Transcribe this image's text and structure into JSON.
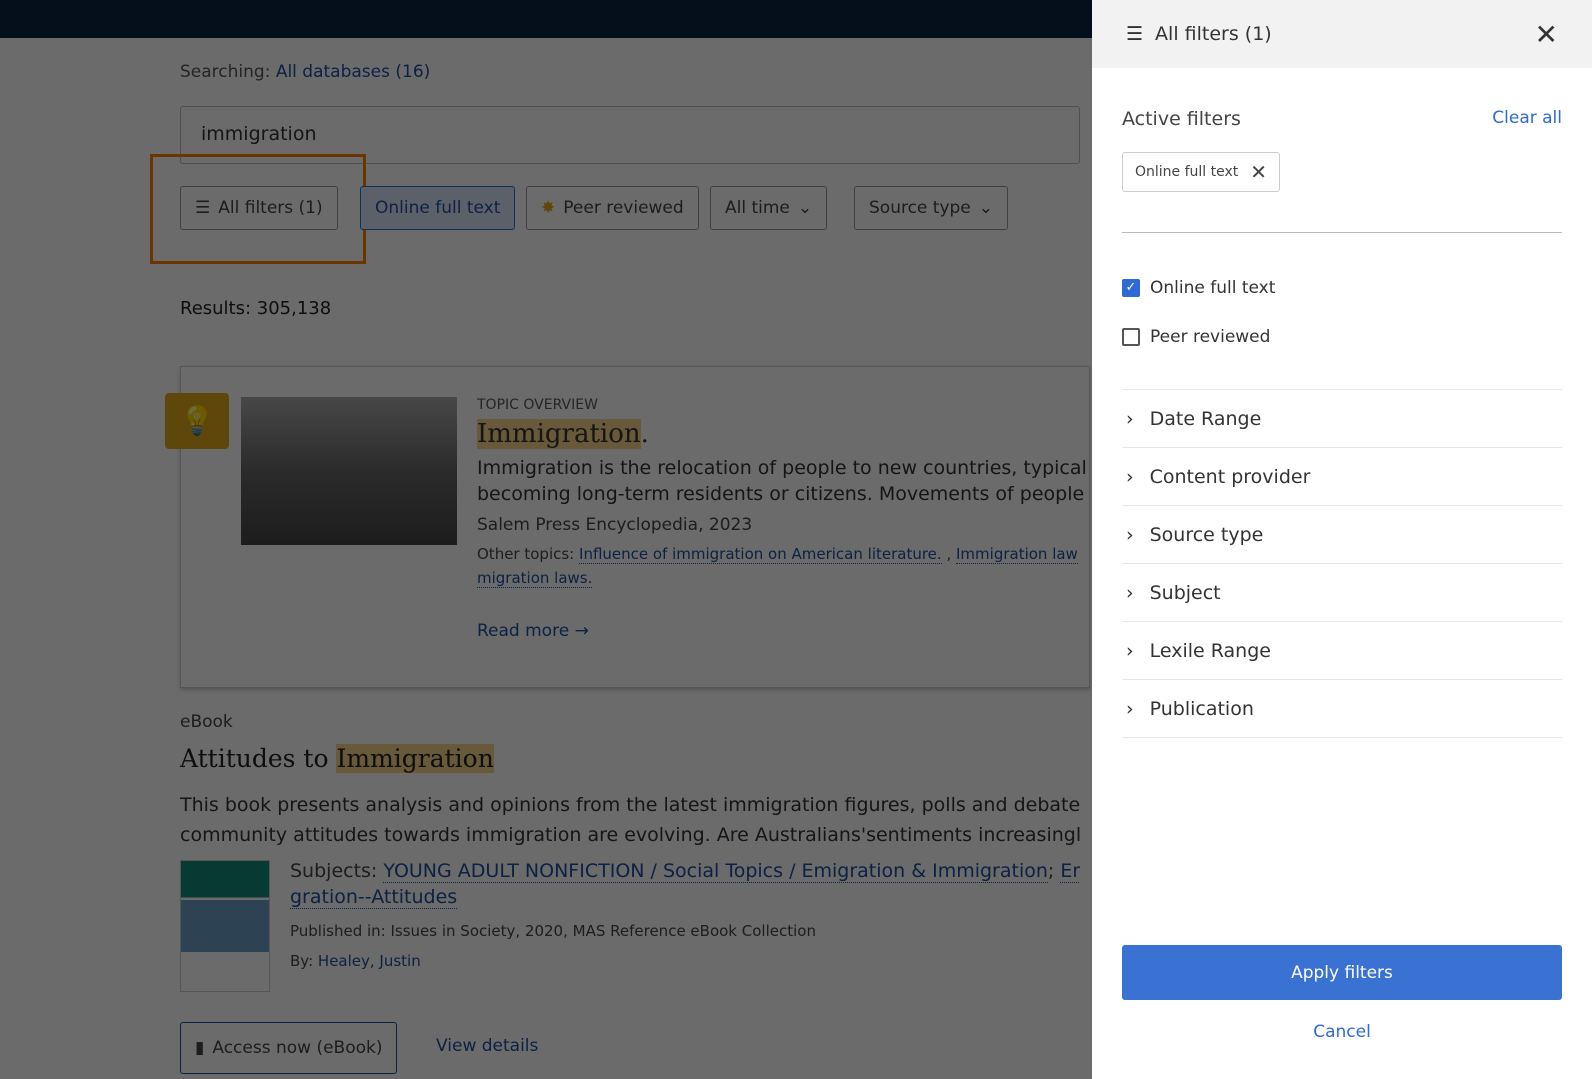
{
  "search": {
    "searching_label": "Searching:",
    "databases": "All databases (16)",
    "query": "immigration"
  },
  "filters": {
    "all_filters": "All filters (1)",
    "online_full_text": "Online full text",
    "peer_reviewed": "Peer reviewed",
    "time": "All time",
    "source_type": "Source type"
  },
  "results": {
    "count_label": "Results: 305,138"
  },
  "topic": {
    "kicker": "TOPIC OVERVIEW",
    "title": "Immigration",
    "title_suffix": ".",
    "desc1": "Immigration is the relocation of people to new countries, typically",
    "desc2": "becoming long-term residents or citizens. Movements of people t",
    "source": "Salem Press Encyclopedia, 2023",
    "other_label": "Other topics:",
    "other1": "Influence of immigration on American literature.",
    "sep": " , ",
    "other2": "Immigration law",
    "other3": "migration laws.",
    "read_more": "Read more"
  },
  "ebook": {
    "type": "eBook",
    "title_pre": "Attitudes to ",
    "title_hl": "Immigration",
    "desc1": "This book presents analysis and opinions from the latest immigration figures, polls and debates t",
    "desc2": "community attitudes towards immigration are evolving. Are Australians'sentiments increasingly p",
    "subjects_label": "Subjects:",
    "subject1": "YOUNG ADULT NONFICTION / Social Topics / Emigration & Immigration",
    "subject2a": "Em",
    "subject2b": "gration--Attitudes",
    "published": "Published in: Issues in Society, 2020, MAS Reference eBook Collection",
    "by_label": "By:",
    "author": "Healey, Justin",
    "access": "Access now (eBook)",
    "details": "View details"
  },
  "panel": {
    "title": "All filters (1)",
    "active_label": "Active filters",
    "clear_all": "Clear all",
    "chip": "Online full text",
    "checkboxes": [
      {
        "label": "Online full text",
        "checked": true
      },
      {
        "label": "Peer reviewed",
        "checked": false
      }
    ],
    "sections": [
      "Date Range",
      "Content provider",
      "Source type",
      "Subject",
      "Lexile Range",
      "Publication"
    ],
    "apply": "Apply filters",
    "cancel": "Cancel"
  },
  "colors": {
    "accent": "#2d6ad1",
    "highlight_outline": "#ff7f00",
    "topbar": "#0c2340"
  }
}
